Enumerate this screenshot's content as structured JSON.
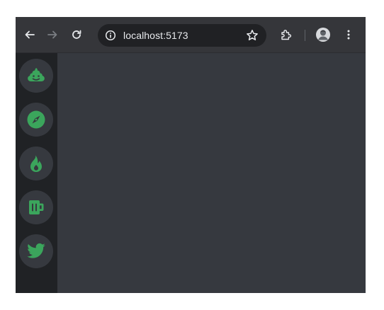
{
  "browser": {
    "url": "localhost:5173",
    "icons": {
      "back": "arrow-left-icon",
      "forward": "arrow-right-icon",
      "reload": "reload-icon",
      "site_info": "info-circle-icon",
      "bookmark": "star-icon",
      "extensions": "puzzle-icon",
      "profile": "avatar-icon",
      "menu": "kebab-menu-icon"
    }
  },
  "sidebar": {
    "accent_color": "#3ba55c",
    "items": [
      {
        "icon": "poop-icon"
      },
      {
        "icon": "compass-icon"
      },
      {
        "icon": "fire-icon"
      },
      {
        "icon": "beer-mug-icon"
      },
      {
        "icon": "twitter-bird-icon"
      }
    ]
  },
  "colors": {
    "toolbar": "#35363a",
    "omnibox": "#202124",
    "sidebar": "#202225",
    "content": "#36393f",
    "icon_bubble": "#36393f"
  }
}
